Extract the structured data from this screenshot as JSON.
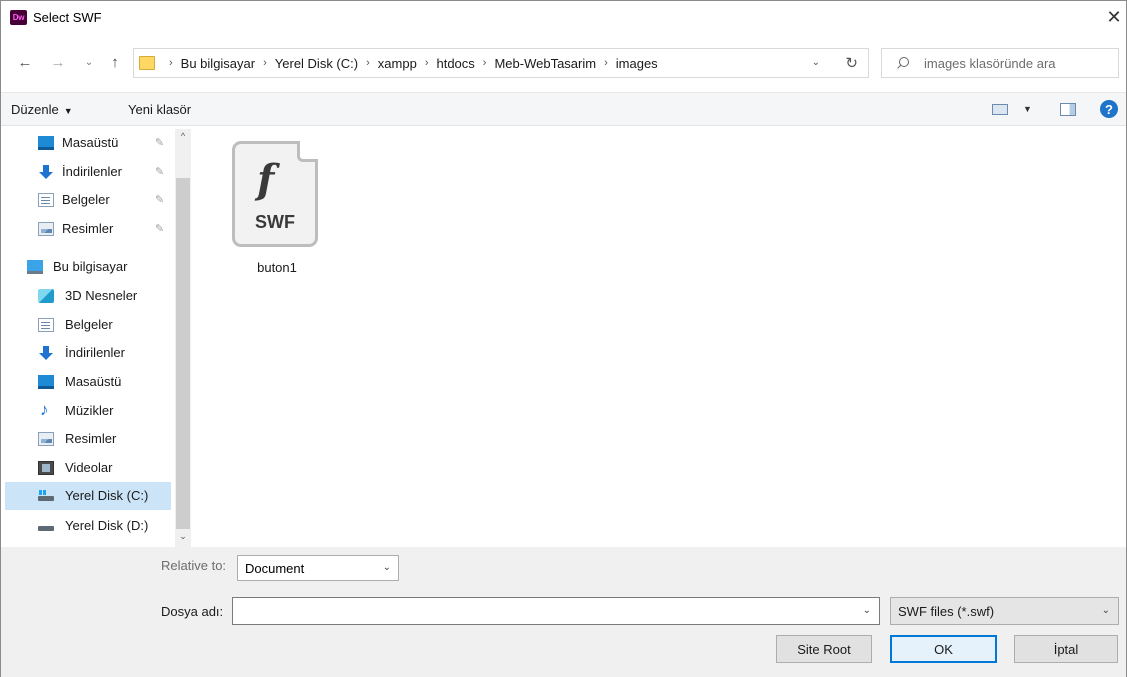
{
  "window": {
    "title": "Select SWF",
    "app_icon_text": "Dw",
    "close_glyph": "✕"
  },
  "nav": {
    "back_glyph": "←",
    "forward_glyph": "→",
    "recent_glyph": "⌄",
    "up_glyph": "↑",
    "refresh_glyph": "↻",
    "dropdown_glyph": "⌄"
  },
  "breadcrumb": [
    "Bu bilgisayar",
    "Yerel Disk (C:)",
    "xampp",
    "htdocs",
    "Meb-WebTasarim",
    "images"
  ],
  "search": {
    "placeholder": "images klasöründe ara"
  },
  "toolbar": {
    "organize_label": "Düzenle",
    "organize_caret": "▼",
    "new_folder_label": "Yeni klasör",
    "view_caret": "▼",
    "help_glyph": "?"
  },
  "sidebar": {
    "quick_access": [
      {
        "label": "Masaüstü",
        "icon": "desktop-icon"
      },
      {
        "label": "İndirilenler",
        "icon": "downloads-icon"
      },
      {
        "label": "Belgeler",
        "icon": "documents-icon"
      },
      {
        "label": "Resimler",
        "icon": "pictures-icon"
      }
    ],
    "this_pc": {
      "label": "Bu bilgisayar",
      "icon": "computer-icon"
    },
    "pc_items": [
      {
        "label": "3D Nesneler",
        "icon": "3d-objects-icon"
      },
      {
        "label": "Belgeler",
        "icon": "documents-icon"
      },
      {
        "label": "İndirilenler",
        "icon": "downloads-icon"
      },
      {
        "label": "Masaüstü",
        "icon": "desktop-icon"
      },
      {
        "label": "Müzikler",
        "icon": "music-icon"
      },
      {
        "label": "Resimler",
        "icon": "pictures-icon"
      },
      {
        "label": "Videolar",
        "icon": "videos-icon"
      },
      {
        "label": "Yerel Disk (C:)",
        "icon": "drive-icon",
        "selected": true
      },
      {
        "label": "Yerel Disk (D:)",
        "icon": "drive-icon"
      }
    ],
    "pin_glyph": "📌",
    "scroll_up_glyph": "^",
    "scroll_down_glyph": "⌄"
  },
  "files": [
    {
      "name": "buton1",
      "type_label": "SWF",
      "icon": "flash-swf-file-icon",
      "logo_glyph": "f"
    }
  ],
  "bottom": {
    "relative_to_label": "Relative to:",
    "relative_to_value": "Document",
    "filename_label": "Dosya adı:",
    "filename_value": "",
    "filetype_value": "SWF files (*.swf)",
    "dropdown_glyph": "⌄",
    "site_root_label": "Site Root",
    "ok_label": "OK",
    "cancel_label": "İptal"
  },
  "colors": {
    "selection": "#cce4f7",
    "accent": "#0078d7",
    "panel_bg": "#f0f0f0",
    "dw_icon_bg": "#470137",
    "dw_icon_fg": "#ff61f6"
  }
}
